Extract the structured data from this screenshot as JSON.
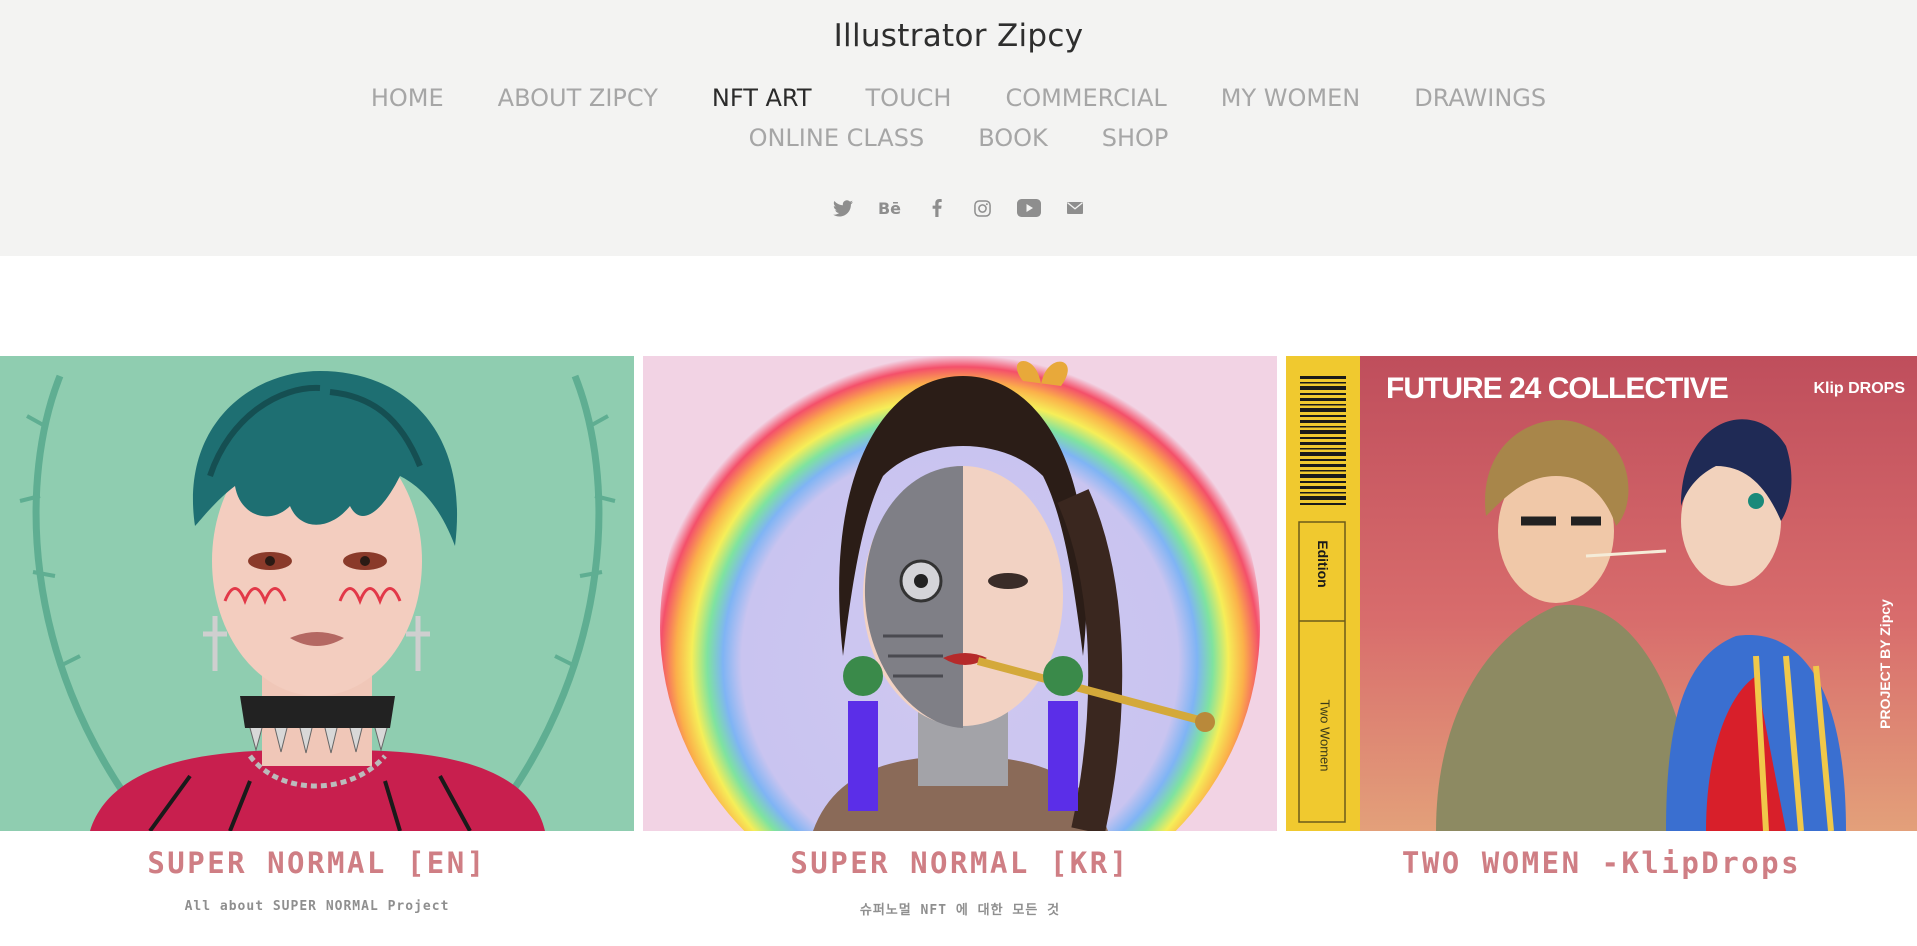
{
  "header": {
    "site_title": "Illustrator Zipcy",
    "nav_row1": [
      "HOME",
      "ABOUT ZIPCY",
      "NFT ART",
      "TOUCH",
      "COMMERCIAL",
      "MY WOMEN",
      "DRAWINGS"
    ],
    "nav_row2": [
      "ONLINE CLASS",
      "BOOK",
      "SHOP"
    ],
    "active_nav": "NFT ART",
    "social_icons": [
      "twitter-icon",
      "behance-icon",
      "facebook-icon",
      "instagram-icon",
      "youtube-icon",
      "email-icon"
    ],
    "behance_glyph": "Bē"
  },
  "cards": [
    {
      "title": "SUPER NORMAL [EN]",
      "subtitle": "All about SUPER NORMAL Project",
      "image": "illustration-green-haired-figure"
    },
    {
      "title": "SUPER NORMAL [KR]",
      "subtitle": "슈퍼노멀 NFT 에 대한 모든 것",
      "image": "illustration-cyborg-woman-rainbow"
    },
    {
      "title": "TWO WOMEN -KlipDrops",
      "subtitle": "",
      "image": "illustration-two-women-smoking",
      "art_text": {
        "collective": "FUTURE 24 COLLECTIVE",
        "klip": "Klip DROPS",
        "edition": "Edition",
        "two_women": "Two Women",
        "project_by": "PROJECT BY Zipcy"
      }
    }
  ],
  "colors": {
    "header_bg": "#f3f3f2",
    "nav_inactive": "#a6a6a6",
    "nav_active": "#2b2b2b",
    "caption_title": "#cf7e84",
    "caption_subtitle": "#8f8f8f"
  }
}
